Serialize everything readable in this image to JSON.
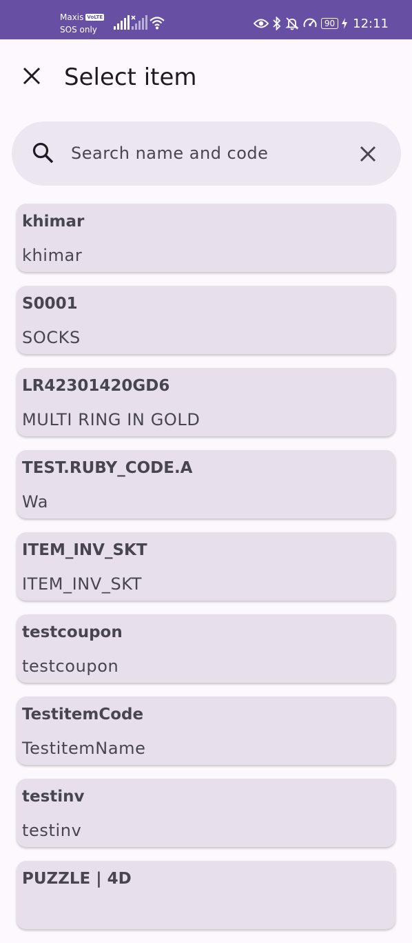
{
  "status_bar": {
    "carrier": "Maxis",
    "volte_badge": "VoLTE",
    "sos": "SOS only",
    "battery": "90",
    "time": "12:11"
  },
  "app_bar": {
    "title": "Select item"
  },
  "search": {
    "placeholder": "Search name and code",
    "value": ""
  },
  "items": [
    {
      "code": "khimar",
      "name": "khimar"
    },
    {
      "code": "S0001",
      "name": "SOCKS"
    },
    {
      "code": "LR42301420GD6",
      "name": "MULTI RING IN GOLD"
    },
    {
      "code": "TEST.RUBY_CODE.A",
      "name": "Wa"
    },
    {
      "code": "ITEM_INV_SKT",
      "name": "ITEM_INV_SKT"
    },
    {
      "code": "testcoupon",
      "name": "testcoupon"
    },
    {
      "code": "TestitemCode",
      "name": "TestitemName"
    },
    {
      "code": "testinv",
      "name": "testinv"
    },
    {
      "code": "PUZZLE | 4D",
      "name": ""
    }
  ],
  "colors": {
    "status_bar": "#6750a4",
    "background": "#fdf8fd",
    "search_fill": "#ece6f0",
    "card_fill": "#e7e0eb",
    "text_secondary": "#49454f"
  }
}
